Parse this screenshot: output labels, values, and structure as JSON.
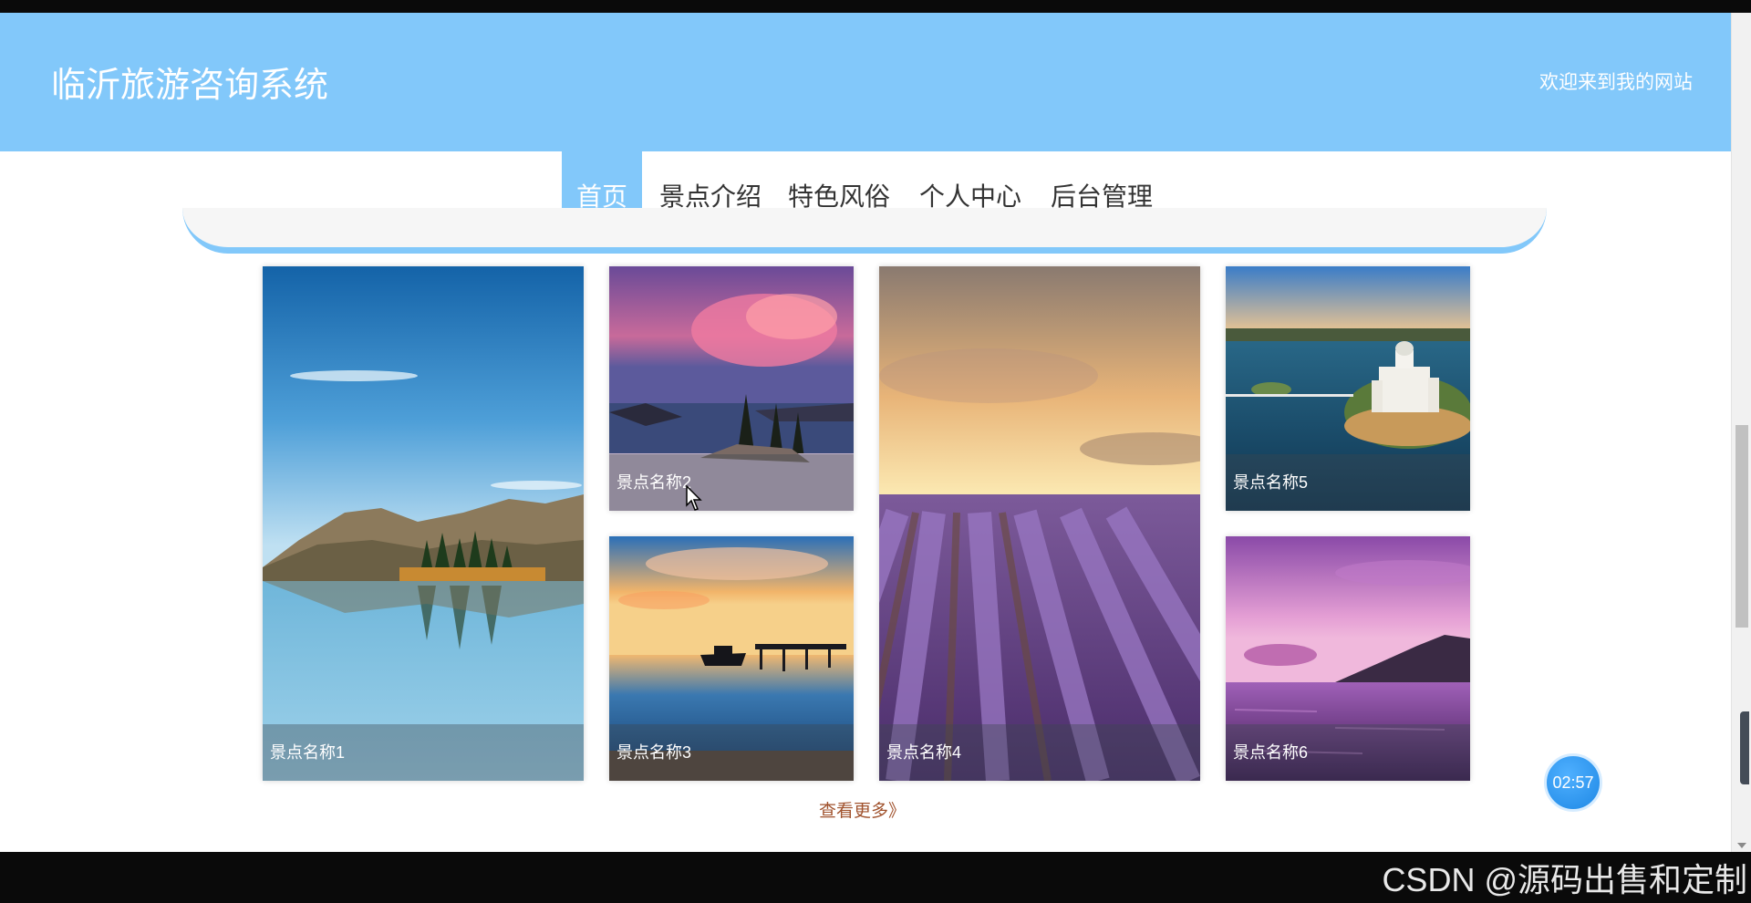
{
  "header": {
    "site_title": "临沂旅游咨询系统",
    "welcome_text": "欢迎来到我的网站",
    "bg_color": "#82c8fa"
  },
  "nav": {
    "items": [
      {
        "label": "首页",
        "active": true
      },
      {
        "label": "景点介绍",
        "active": false
      },
      {
        "label": "特色风俗",
        "active": false
      },
      {
        "label": "个人中心",
        "active": false
      },
      {
        "label": "后台管理",
        "active": false
      }
    ]
  },
  "gallery": {
    "cards": [
      {
        "caption": "景点名称1",
        "scene": "mountain-lake-reflection"
      },
      {
        "caption": "景点名称2",
        "scene": "crater-lake-pink-clouds"
      },
      {
        "caption": "景点名称3",
        "scene": "sunset-pier-boat"
      },
      {
        "caption": "景点名称4",
        "scene": "lavender-field-sunset"
      },
      {
        "caption": "景点名称5",
        "scene": "island-castle-aerial"
      },
      {
        "caption": "景点名称6",
        "scene": "purple-sea-sunset"
      }
    ],
    "more_link": "查看更多》"
  },
  "timer": {
    "label": "02:57"
  },
  "watermark": {
    "text": "CSDN @源码出售和定制"
  }
}
